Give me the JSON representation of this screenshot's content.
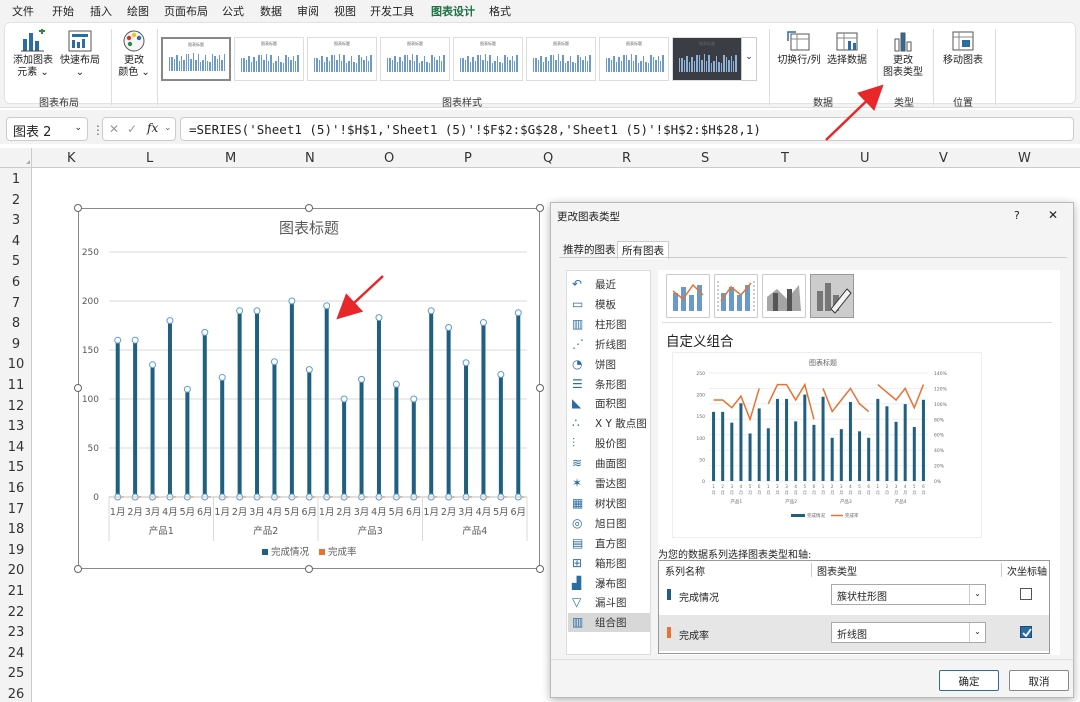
{
  "menu": {
    "tabs": [
      "文件",
      "开始",
      "插入",
      "绘图",
      "页面布局",
      "公式",
      "数据",
      "审阅",
      "视图",
      "开发工具",
      "图表设计",
      "格式"
    ],
    "active": "图表设计"
  },
  "ribbon": {
    "add_element": "添加图表\n元素 ⌄",
    "quick_layout": "快速布局\n⌄",
    "change_colors": "更改\n颜色 ⌄",
    "group_layout": "图表布局",
    "group_styles": "图表样式",
    "switch_row_col": "切换行/列",
    "select_data": "选择数据",
    "group_data": "数据",
    "change_type": "更改\n图表类型",
    "group_type": "类型",
    "move_chart": "移动图表",
    "group_location": "位置",
    "thumb_title": "图表标题"
  },
  "formula_bar": {
    "name_box": "图表 2",
    "cancel": "✕",
    "enter": "✓",
    "fx": "fx",
    "formula": "=SERIES('Sheet1 (5)'!$H$1,'Sheet1 (5)'!$F$2:$G$28,'Sheet1 (5)'!$H$2:$H$28,1)"
  },
  "columns": [
    "K",
    "L",
    "M",
    "N",
    "O",
    "P",
    "Q",
    "R",
    "S",
    "T",
    "U",
    "V",
    "W"
  ],
  "rows": [
    "1",
    "2",
    "3",
    "4",
    "5",
    "6",
    "7",
    "8",
    "9",
    "10",
    "11",
    "12",
    "13",
    "14",
    "15",
    "16",
    "17",
    "18",
    "19",
    "20",
    "21",
    "22",
    "23",
    "24",
    "25",
    "26"
  ],
  "chart_data": {
    "type": "bar",
    "title": "图表标题",
    "ylim": [
      0,
      250
    ],
    "yticks": [
      0,
      50,
      100,
      150,
      200,
      250
    ],
    "groups": [
      "产品1",
      "产品2",
      "产品3",
      "产品4"
    ],
    "months": [
      "1月",
      "2月",
      "3月",
      "4月",
      "5月",
      "6月"
    ],
    "series": [
      {
        "name": "完成情况",
        "color": "#1f5f7f",
        "values": [
          160,
          160,
          135,
          180,
          110,
          168,
          122,
          190,
          190,
          138,
          200,
          130,
          195,
          100,
          120,
          183,
          115,
          100,
          190,
          173,
          137,
          178,
          125,
          188
        ]
      },
      {
        "name": "完成率",
        "color": "#e97132",
        "values": []
      }
    ],
    "legend": "bottom",
    "grid": true
  },
  "dialog": {
    "title": "更改图表类型",
    "help": "?",
    "close": "✕",
    "tabs": [
      "推荐的图表",
      "所有图表"
    ],
    "active_tab": "所有图表",
    "types": [
      "最近",
      "模板",
      "柱形图",
      "折线图",
      "饼图",
      "条形图",
      "面积图",
      "X Y 散点图",
      "股价图",
      "曲面图",
      "雷达图",
      "树状图",
      "旭日图",
      "直方图",
      "箱形图",
      "瀑布图",
      "漏斗图",
      "组合图"
    ],
    "selected_type": "组合图",
    "combo_heading": "自定义组合",
    "preview": {
      "title": "图表标题",
      "yticks_left": [
        "250",
        "200",
        "150",
        "100",
        "50",
        "0"
      ],
      "yticks_right": [
        "140%",
        "120%",
        "100%",
        "80%",
        "60%",
        "40%",
        "20%",
        "0%"
      ],
      "groups": [
        "产品1",
        "产品2",
        "产品3",
        "产品4"
      ],
      "month_nums": [
        "1",
        "2",
        "3",
        "4",
        "5",
        "6"
      ],
      "month_unit": "月",
      "legend": [
        "完成情况",
        "完成率"
      ],
      "line_values": [
        1.05,
        1.05,
        0.95,
        1.1,
        0.8,
        1.2,
        1.0,
        1.25,
        1.25,
        1.05,
        1.25,
        0.8,
        1.2,
        0.9,
        1.05,
        1.2,
        1.0,
        0.9,
        1.25,
        1.15,
        1.05,
        1.2,
        0.95,
        1.25
      ]
    },
    "series_label": "为您的数据系列选择图表类型和轴:",
    "col_series": "系列名称",
    "col_type": "图表类型",
    "col_axis": "次坐标轴",
    "rows": [
      {
        "name": "完成情况",
        "color": "#1f5f7f",
        "type": "簇状柱形图",
        "secondary": false
      },
      {
        "name": "完成率",
        "color": "#e97132",
        "type": "折线图",
        "secondary": true
      }
    ],
    "ok": "确定",
    "cancel": "取消"
  }
}
